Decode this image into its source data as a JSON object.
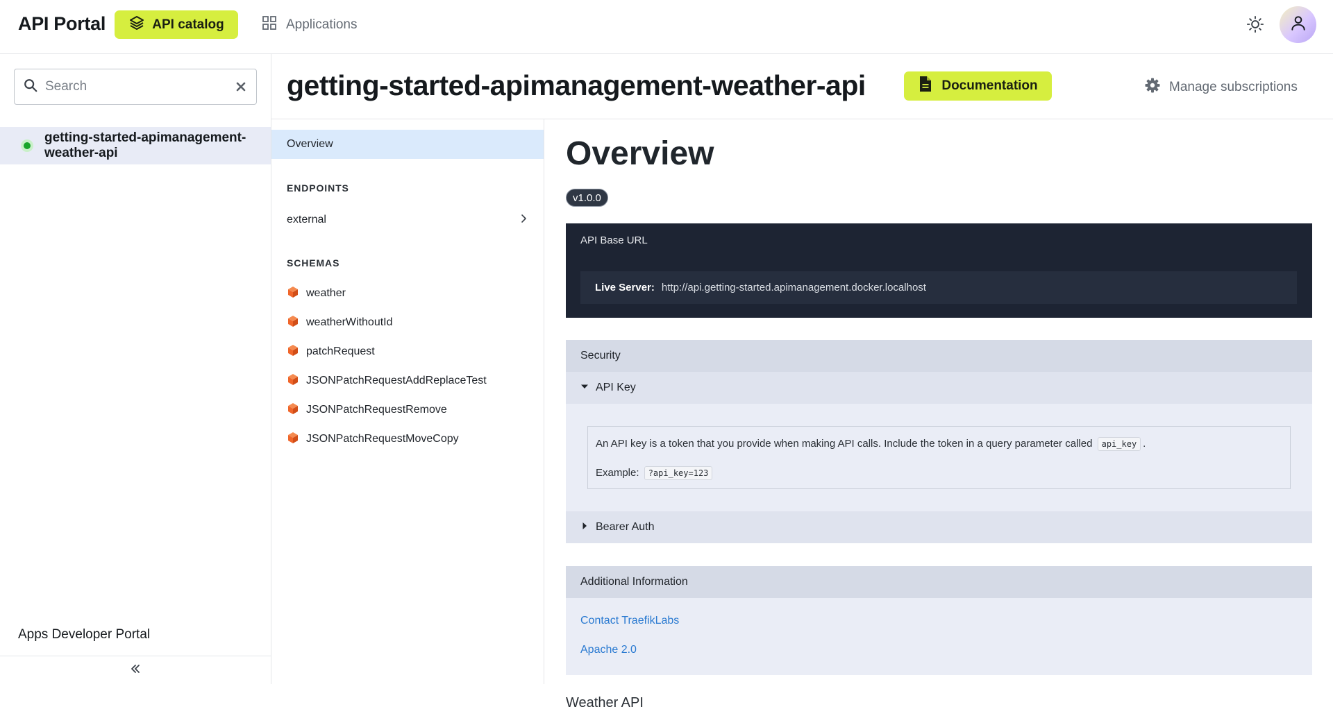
{
  "header": {
    "brand": "API Portal",
    "nav": {
      "catalog_label": "API catalog",
      "applications_label": "Applications"
    },
    "icons": {
      "catalog": "layers-icon",
      "applications": "grid-icon",
      "theme": "sun-icon",
      "avatar": "user-icon"
    }
  },
  "sidebar": {
    "search": {
      "placeholder": "Search",
      "value": ""
    },
    "apis": [
      {
        "label": "getting-started-apimanagement-weather-api",
        "status": "online"
      }
    ],
    "footer_label": "Apps Developer Portal"
  },
  "api_header": {
    "title": "getting-started-apimanagement-weather-api",
    "documentation_label": "Documentation",
    "manage_label": "Manage subscriptions"
  },
  "midnav": {
    "overview_label": "Overview",
    "endpoints_heading": "ENDPOINTS",
    "endpoints": [
      {
        "label": "external"
      }
    ],
    "schemas_heading": "SCHEMAS",
    "schemas": [
      {
        "label": "weather"
      },
      {
        "label": "weatherWithoutId"
      },
      {
        "label": "patchRequest"
      },
      {
        "label": "JSONPatchRequestAddReplaceTest"
      },
      {
        "label": "JSONPatchRequestRemove"
      },
      {
        "label": "JSONPatchRequestMoveCopy"
      }
    ]
  },
  "main": {
    "title": "Overview",
    "version": "v1.0.0",
    "base_url": {
      "heading": "API Base URL",
      "server_label": "Live Server:",
      "server_url": "http://api.getting-started.apimanagement.docker.localhost"
    },
    "security": {
      "heading": "Security",
      "api_key": {
        "label": "API Key",
        "description": "An API key is a token that you provide when making API calls. Include the token in a query parameter called",
        "param": "api_key",
        "description_end": ".",
        "example_label": "Example:",
        "example_value": "?api_key=123"
      },
      "bearer_label": "Bearer Auth"
    },
    "additional": {
      "heading": "Additional Information",
      "contact": "Contact TraefikLabs",
      "license": "Apache 2.0"
    },
    "footer_title": "Weather API"
  },
  "colors": {
    "accent": "#d6ee3f",
    "selected_bg": "#e8ebf6",
    "nav_selected_bg": "#daeafc",
    "dark_panel": "#1d2433",
    "link": "#2a7ad1",
    "status_online": "#18a52a",
    "schema_icon": "#f0662a"
  }
}
